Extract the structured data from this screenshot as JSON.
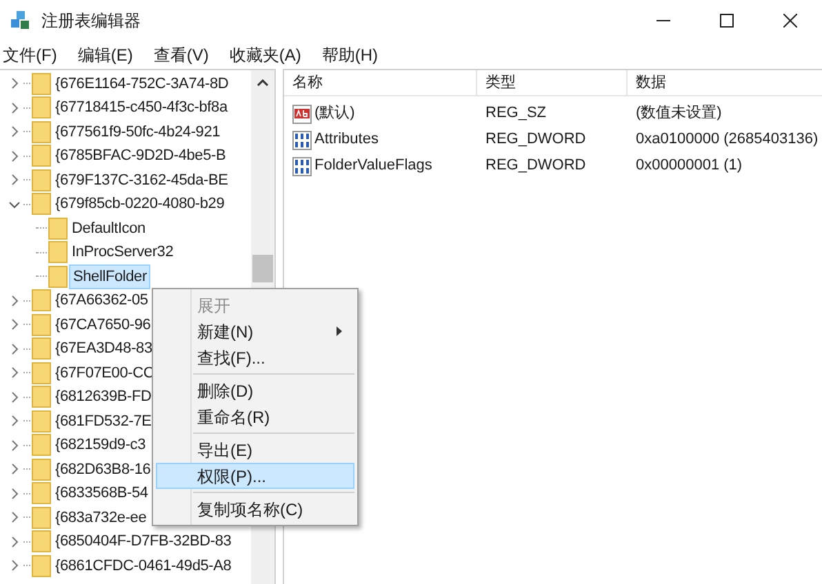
{
  "window": {
    "title": "注册表编辑器"
  },
  "menu_bar": [
    {
      "label": "文件(F)"
    },
    {
      "label": "编辑(E)"
    },
    {
      "label": "查看(V)"
    },
    {
      "label": "收藏夹(A)"
    },
    {
      "label": "帮助(H)"
    }
  ],
  "tree": [
    {
      "label": "{676E1164-752C-3A74-8D",
      "expanded": false,
      "selected": false
    },
    {
      "label": "{67718415-c450-4f3c-bf8a",
      "expanded": false,
      "selected": false
    },
    {
      "label": "{677561f9-50fc-4b24-921",
      "expanded": false,
      "selected": false
    },
    {
      "label": "{6785BFAC-9D2D-4be5-B",
      "expanded": false,
      "selected": false
    },
    {
      "label": "{679F137C-3162-45da-BE",
      "expanded": false,
      "selected": false
    },
    {
      "label": "{679f85cb-0220-4080-b29",
      "expanded": true,
      "selected": false,
      "children": [
        {
          "label": "DefaultIcon",
          "selected": false
        },
        {
          "label": "InProcServer32",
          "selected": false
        },
        {
          "label": "ShellFolder",
          "selected": true
        }
      ]
    },
    {
      "label": "{67A66362-05",
      "expanded": false,
      "selected": false
    },
    {
      "label": "{67CA7650-96",
      "expanded": false,
      "selected": false
    },
    {
      "label": "{67EA3D48-83",
      "expanded": false,
      "selected": false
    },
    {
      "label": "{67F07E00-CC",
      "expanded": false,
      "selected": false
    },
    {
      "label": "{6812639B-FD",
      "expanded": false,
      "selected": false
    },
    {
      "label": "{681FD532-7E",
      "expanded": false,
      "selected": false
    },
    {
      "label": "{682159d9-c3",
      "expanded": false,
      "selected": false
    },
    {
      "label": "{682D63B8-16",
      "expanded": false,
      "selected": false
    },
    {
      "label": "{6833568B-54",
      "expanded": false,
      "selected": false
    },
    {
      "label": "{683a732e-ee",
      "expanded": false,
      "selected": false
    },
    {
      "label": "{6850404F-D7FB-32BD-83",
      "expanded": false,
      "selected": false
    },
    {
      "label": "{6861CFDC-0461-49d5-A8",
      "expanded": false,
      "selected": false
    }
  ],
  "values_table": {
    "columns": [
      "名称",
      "类型",
      "数据"
    ],
    "rows": [
      {
        "kind": "string",
        "name": "(默认)",
        "type": "REG_SZ",
        "data": "(数值未设置)"
      },
      {
        "kind": "binary",
        "name": "Attributes",
        "type": "REG_DWORD",
        "data": "0xa0100000 (2685403136)"
      },
      {
        "kind": "binary",
        "name": "FolderValueFlags",
        "type": "REG_DWORD",
        "data": "0x00000001 (1)"
      }
    ]
  },
  "context_menu": [
    {
      "kind": "item",
      "label": "展开",
      "disabled": true,
      "submenu": false,
      "selected": false
    },
    {
      "kind": "item",
      "label": "新建(N)",
      "disabled": false,
      "submenu": true,
      "selected": false
    },
    {
      "kind": "item",
      "label": "查找(F)...",
      "disabled": false,
      "submenu": false,
      "selected": false
    },
    {
      "kind": "separator"
    },
    {
      "kind": "item",
      "label": "删除(D)",
      "disabled": false,
      "submenu": false,
      "selected": false
    },
    {
      "kind": "item",
      "label": "重命名(R)",
      "disabled": false,
      "submenu": false,
      "selected": false
    },
    {
      "kind": "separator"
    },
    {
      "kind": "item",
      "label": "导出(E)",
      "disabled": false,
      "submenu": false,
      "selected": false
    },
    {
      "kind": "item",
      "label": "权限(P)...",
      "disabled": false,
      "submenu": false,
      "selected": true
    },
    {
      "kind": "separator"
    },
    {
      "kind": "item",
      "label": "复制项名称(C)",
      "disabled": false,
      "submenu": false,
      "selected": false
    }
  ]
}
